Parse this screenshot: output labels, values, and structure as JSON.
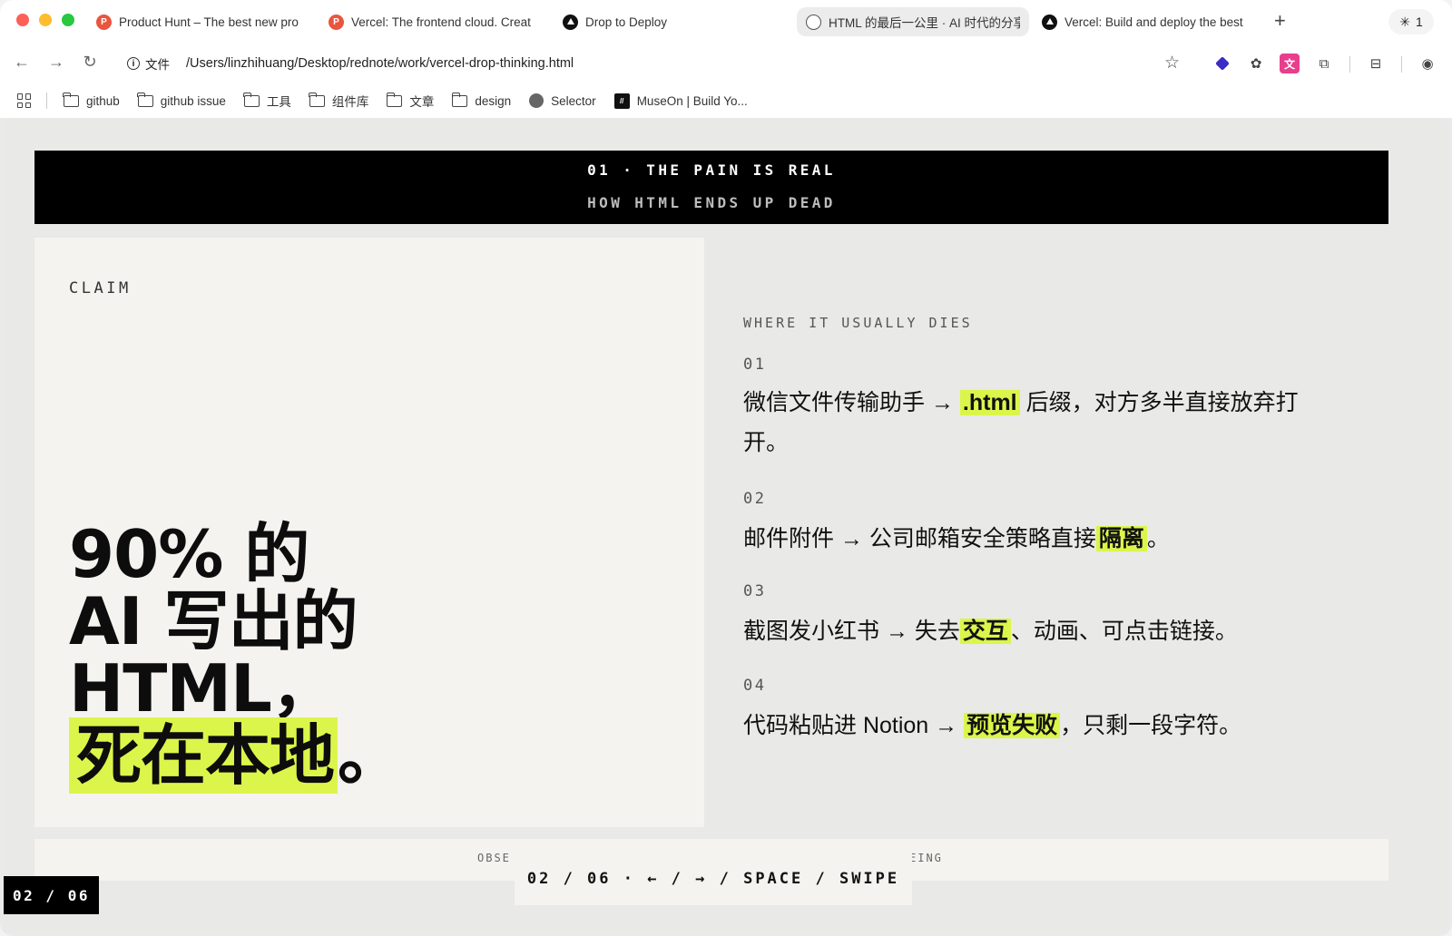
{
  "browser": {
    "tabs": [
      {
        "label": "Product Hunt – The best new pro",
        "favicon": "P"
      },
      {
        "label": "Vercel: The frontend cloud. Creat",
        "favicon": "P"
      },
      {
        "label": "Drop to Deploy",
        "favicon": ""
      },
      {
        "label": "HTML 的最后一公里 · AI 时代的分享",
        "favicon": ""
      },
      {
        "label": "Vercel: Build and deploy the best",
        "favicon": ""
      }
    ],
    "new_tab": "+",
    "tab_count": "1",
    "url_chip": "文件",
    "url": "/Users/linzhihuang/Desktop/rednote/work/vercel-drop-thinking.html",
    "bookmarks": [
      {
        "label": "github"
      },
      {
        "label": "github issue"
      },
      {
        "label": "工具"
      },
      {
        "label": "组件库"
      },
      {
        "label": "文章"
      },
      {
        "label": "design"
      },
      {
        "label": "Selector"
      },
      {
        "label": "MuseOn | Build Yo..."
      }
    ]
  },
  "slide": {
    "banner_title": "01 · THE PAIN IS REAL",
    "banner_sub": "HOW HTML ENDS UP DEAD",
    "claim_label": "CLAIM",
    "headline": {
      "line1": "90% 的",
      "line2": "AI 写出的",
      "line3": "HTML，",
      "line4_mark": "死在本地",
      "line4_tail": "。"
    },
    "dies_label": "WHERE IT USUALLY DIES",
    "items": [
      {
        "num": "01",
        "pre": "微信文件传输助手 → ",
        "mark": ".html",
        "post": " 后缀，对方多半直接放弃打开。"
      },
      {
        "num": "02",
        "pre": "邮件附件 → 公司邮箱安全策略直接",
        "mark": "隔离",
        "post": "。"
      },
      {
        "num": "03",
        "pre": "截图发小红书 → 失去",
        "mark": "交互",
        "post": "、动画、可点击链接。"
      },
      {
        "num": "04",
        "pre": "代码粘贴进 Notion → ",
        "mark": "预览失败",
        "post": "，只剩一段字符。"
      }
    ],
    "footer_left_fade": "OBSE",
    "footer_right_fade": "EING",
    "footer_nav": "02 / 06 · ← / → / SPACE / SWIPE",
    "page_counter": "02 / 06"
  },
  "colors": {
    "accent_highlight": "#dcf54a",
    "banner_bg": "#000000",
    "panel_bg": "#f4f3ef",
    "page_bg": "#e9e9e7"
  }
}
